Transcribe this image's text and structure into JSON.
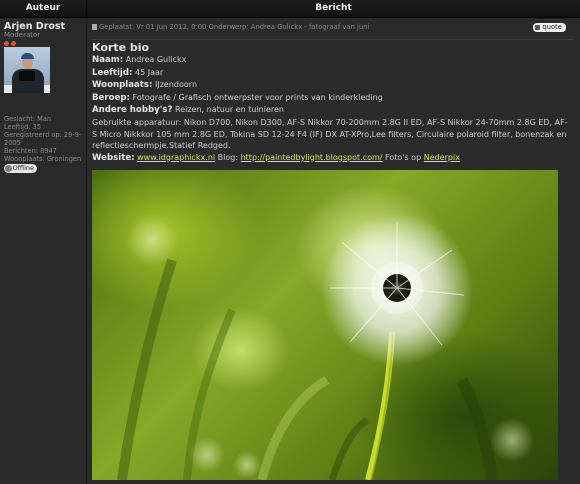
{
  "header": {
    "col_author": "Auteur",
    "col_post": "Bericht"
  },
  "author": {
    "name": "Arjen Drost",
    "role": "Moderator",
    "stats": [
      "Geslacht: Man",
      "Leeftijd: 35",
      "Geregistreerd op: 29-9-2005",
      "Berichten: 8947",
      "Woonplaats: Groningen"
    ],
    "status": "Offline"
  },
  "post": {
    "meta": "Geplaatst: Vr 01 Jun 2012, 0:00    Onderwerp: Andrea Gulickx - fotograaf van juni",
    "quote_label": "quote",
    "title": "Korte bio",
    "name_label": "Naam:",
    "name_value": "Andrea Gulickx",
    "age_label": "Leeftijd:",
    "age_value": "45 Jaar",
    "residence_label": "Woonplaats:",
    "residence_value": "IJzendoorn",
    "job_label": "Beroep:",
    "job_value": "Fotografe / Grafisch ontwerpster voor prints van kinderkleding",
    "hobby_label": "Andere hobby's?",
    "hobby_value": "Reizen, natuur en tuinieren",
    "equipment": "Gebruikte apparatuur: Nikon D700, Nikon D300, AF-S Nikkor 70-200mm 2.8G II ED, AF-S Nikkor 24-70mm 2.8G ED, AF-S Micro Nikkkor 105 mm 2.8G ED, Tokina SD 12-24 F4 (IF) DX AT-XPro,Lee filters, Circulaire polaroid filter, bonenzak en reflectieschermpje.Statief Redged.",
    "website_label": "Website:",
    "website_link": "www.idgraphickx.nl",
    "blog_label": " Blog: ",
    "blog_link": "http://paintedbylight.blogspot.com/",
    "photos_label": " Foto's op ",
    "photos_link": "Nederpix"
  },
  "colors": {
    "accent_link": "#d8e65a",
    "status_dot": "#d9532c"
  }
}
